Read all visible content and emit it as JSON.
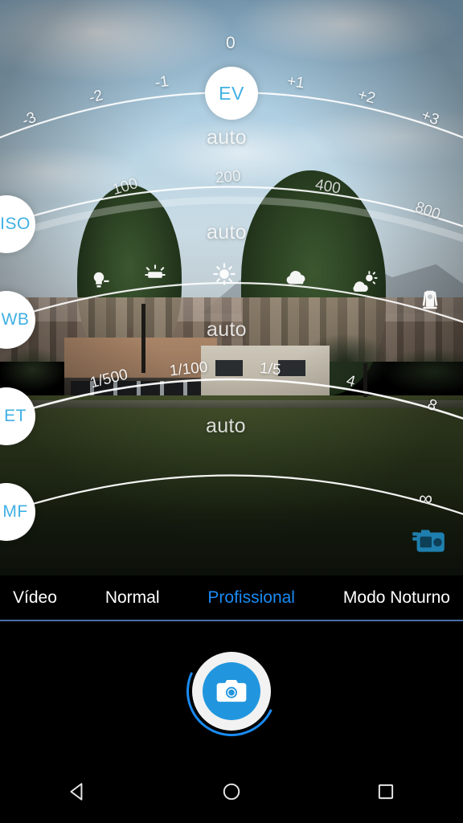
{
  "app": {
    "name": "Camera",
    "active_mode": "Profissional"
  },
  "colors": {
    "accent_blue": "#1a8bf2",
    "knob_text_blue": "#41b0e4",
    "shutter_blue": "#2196de",
    "overlay_white": "#ffffff"
  },
  "controls": [
    {
      "id": "ev",
      "knob_label": "EV",
      "value_label": "auto",
      "ticks": [
        "-3",
        "-2",
        "-1",
        "0",
        "+1",
        "+2",
        "+3"
      ]
    },
    {
      "id": "iso",
      "knob_label": "ISO",
      "value_label": "auto",
      "ticks": [
        "100",
        "200",
        "400",
        "800"
      ]
    },
    {
      "id": "wb",
      "knob_label": "WB",
      "value_label": "auto",
      "ticks": [],
      "icons": [
        "incandescent-icon",
        "fluorescent-icon",
        "sunny-icon",
        "cloudy-icon",
        "partly-cloudy-icon",
        "twilight-icon"
      ]
    },
    {
      "id": "et",
      "knob_label": "ET",
      "value_label": "auto",
      "ticks": [
        "1/500",
        "1/100",
        "1/5",
        "4",
        "8"
      ]
    },
    {
      "id": "mf",
      "knob_label": "MF",
      "value_label": "",
      "ticks": [
        "∞"
      ]
    }
  ],
  "viewfinder": {
    "camera_switch_icon": "dslr-camera-icon"
  },
  "modes": [
    {
      "label": "Vídeo",
      "active": false
    },
    {
      "label": "Normal",
      "active": false
    },
    {
      "label": "Profissional",
      "active": true
    },
    {
      "label": "Modo Noturno",
      "active": false
    }
  ],
  "shutter": {
    "icon": "camera-icon",
    "label": "Shutter"
  },
  "navbar": {
    "back": "back-icon",
    "home": "home-icon",
    "recents": "recents-icon"
  }
}
